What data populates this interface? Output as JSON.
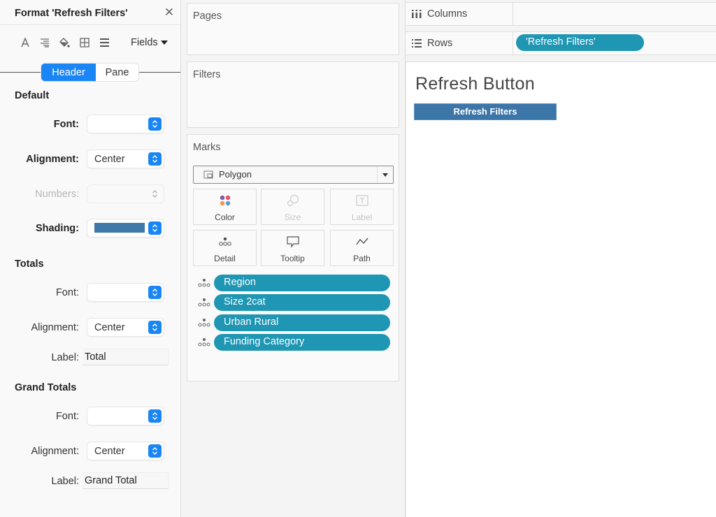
{
  "format_panel": {
    "title": "Format 'Refresh Filters'",
    "close_icon": "close-icon",
    "toolbar": {
      "icons": [
        "font-icon",
        "alignment-icon",
        "shading-icon",
        "borders-icon",
        "lines-icon"
      ],
      "fields_label": "Fields"
    },
    "segments": {
      "active": "Header",
      "inactive": "Pane"
    },
    "default": {
      "title": "Default",
      "font_label": "Font:",
      "font_value": "",
      "alignment_label": "Alignment:",
      "alignment_value": "Center",
      "numbers_label": "Numbers:",
      "numbers_value": "",
      "shading_label": "Shading:",
      "shading_color": "#3f78a9"
    },
    "totals": {
      "title": "Totals",
      "font_label": "Font:",
      "font_value": "",
      "alignment_label": "Alignment:",
      "alignment_value": "Center",
      "label_label": "Label:",
      "label_value": "Total"
    },
    "grand_totals": {
      "title": "Grand Totals",
      "font_label": "Font:",
      "font_value": "",
      "alignment_label": "Alignment:",
      "alignment_value": "Center",
      "label_label": "Label:",
      "label_value": "Grand Total"
    }
  },
  "shelves": {
    "pages_title": "Pages",
    "filters_title": "Filters",
    "marks": {
      "title": "Marks",
      "mark_type": "Polygon",
      "buttons": [
        {
          "label": "Color",
          "icon": "color-icon",
          "enabled": true
        },
        {
          "label": "Size",
          "icon": "size-icon",
          "enabled": false
        },
        {
          "label": "Label",
          "icon": "label-icon",
          "enabled": false
        },
        {
          "label": "Detail",
          "icon": "detail-icon",
          "enabled": true
        },
        {
          "label": "Tooltip",
          "icon": "tooltip-icon",
          "enabled": true
        },
        {
          "label": "Path",
          "icon": "path-icon",
          "enabled": true
        }
      ],
      "detail_pills": [
        "Region",
        "Size 2cat",
        "Urban Rural",
        "Funding Category"
      ]
    }
  },
  "columns_shelf": {
    "label": "Columns",
    "pills": []
  },
  "rows_shelf": {
    "label": "Rows",
    "pills": [
      "'Refresh Filters'"
    ]
  },
  "view": {
    "title": "Refresh Button",
    "button_label": "Refresh Filters",
    "button_color": "#3c76a8"
  },
  "colors": {
    "accent": "#1a86f5",
    "pill": "#1f96b3"
  }
}
